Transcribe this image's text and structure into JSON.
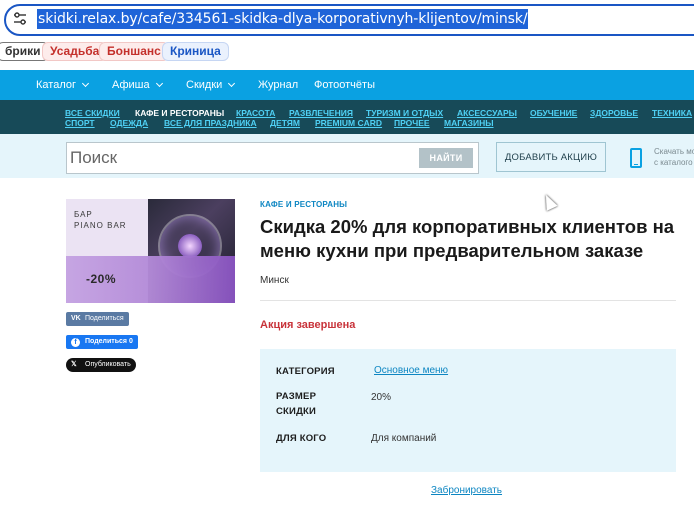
{
  "browser": {
    "url": "skidki.relax.by/cafe/334561-skidka-dlya-korporativnyh-klijentov/minsk/",
    "bookmarks": [
      {
        "label": "брики"
      },
      {
        "label": "Усадьба"
      },
      {
        "label": "Боншанс"
      },
      {
        "label": "Криница"
      }
    ]
  },
  "nav": {
    "items": [
      "Каталог",
      "Афиша",
      "Скидки",
      "Журнал",
      "Фотоотчёты"
    ]
  },
  "categories": {
    "row1": [
      "ВСЕ СКИДКИ",
      "КАФЕ И РЕСТОРАНЫ",
      "КРАСОТА",
      "РАЗВЛЕЧЕНИЯ",
      "ТУРИЗМ И ОТДЫХ",
      "АКСЕССУАРЫ",
      "ОБУЧЕНИЕ",
      "ЗДОРОВЬЕ",
      "ТЕХНИКА"
    ],
    "row2": [
      "СПОРТ",
      "ОДЕЖДА",
      "ВСЕ ДЛЯ ПРАЗДНИКА",
      "ДЕТЯМ",
      "PREMIUM CARD",
      "ПРОЧЕЕ",
      "МАГАЗИНЫ"
    ]
  },
  "search": {
    "placeholder": "Поиск",
    "button": "НАЙТИ",
    "add_button": "ДОБАВИТЬ АКЦИЮ",
    "app_line1": "Скачать мо",
    "app_line2": "с каталого"
  },
  "promo": {
    "title_line1": "БАР",
    "title_line2": "PIANO BAR",
    "discount": "-20%"
  },
  "share": {
    "vk": "Поделиться",
    "fb": "Поделиться 0",
    "x": "Опубликовать"
  },
  "offer": {
    "breadcrumb": "КАФЕ И РЕСТОРАНЫ",
    "title": "Скидка 20% для корпоративных клиентов на меню кухни при предварительном заказе",
    "city": "Минск",
    "status": "Акция завершена",
    "details": {
      "category_label": "КАТЕГОРИЯ",
      "category_value": "Основное меню",
      "size_label_1": "РАЗМЕР",
      "size_label_2": "СКИДКИ",
      "size_value": "20%",
      "for_label": "ДЛЯ КОГО",
      "for_value": "Для компаний"
    },
    "book_link": "Забронировать"
  },
  "colors": {
    "nav_blue": "#0aa1e2",
    "category_bar": "#174a58",
    "status_red": "#c8333a",
    "link_blue": "#0d86c2"
  }
}
